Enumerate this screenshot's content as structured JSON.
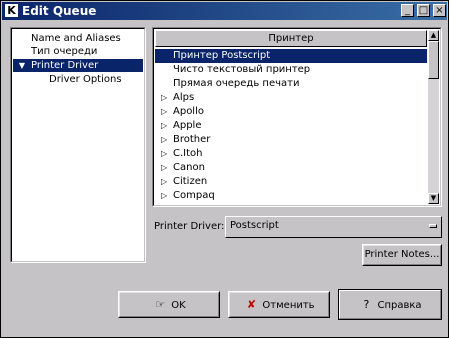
{
  "window": {
    "title": "Edit Queue",
    "app_glyph": "K",
    "controls": {
      "minimize": "_",
      "maximize": "□",
      "close": "×"
    }
  },
  "sidebar": {
    "items": [
      {
        "label": "Name and Aliases",
        "selected": false
      },
      {
        "label": "Тип очереди",
        "selected": false
      },
      {
        "label": "Printer Driver",
        "selected": true,
        "expanded": true
      },
      {
        "label": "Driver Options",
        "selected": false,
        "child": true
      }
    ]
  },
  "driver_list": {
    "header": "Принтер",
    "rows": [
      {
        "label": "Принтер Postscript",
        "selected": true,
        "expandable": false
      },
      {
        "label": "Чисто текстовый принтер",
        "selected": false,
        "expandable": false
      },
      {
        "label": "Прямая очередь печати",
        "selected": false,
        "expandable": false
      },
      {
        "label": "Alps",
        "selected": false,
        "expandable": true
      },
      {
        "label": "Apollo",
        "selected": false,
        "expandable": true
      },
      {
        "label": "Apple",
        "selected": false,
        "expandable": true
      },
      {
        "label": "Brother",
        "selected": false,
        "expandable": true
      },
      {
        "label": "C.Itoh",
        "selected": false,
        "expandable": true
      },
      {
        "label": "Canon",
        "selected": false,
        "expandable": true
      },
      {
        "label": "Citizen",
        "selected": false,
        "expandable": true
      },
      {
        "label": "Compaq",
        "selected": false,
        "expandable": true
      }
    ]
  },
  "printer_driver": {
    "label": "Printer Driver:",
    "value": "Postscript"
  },
  "buttons": {
    "printer_notes": "Printer Notes...",
    "ok": "OK",
    "cancel": "Отменить",
    "help": "Справка"
  }
}
